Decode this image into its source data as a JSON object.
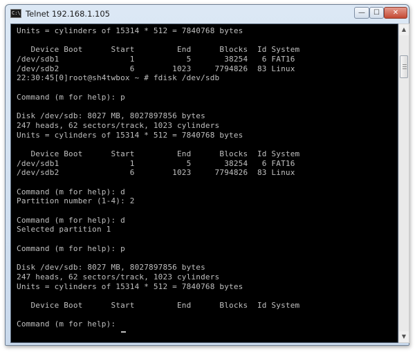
{
  "window": {
    "title": "Telnet 192.168.1.105",
    "icon_label": "C:\\",
    "minimize_glyph": "—",
    "maximize_glyph": "☐",
    "close_glyph": "✕"
  },
  "console": {
    "lines": [
      "Units = cylinders of 15314 * 512 = 7840768 bytes",
      "",
      "   Device Boot      Start         End      Blocks  Id System",
      "/dev/sdb1               1           5       38254   6 FAT16",
      "/dev/sdb2               6        1023     7794826  83 Linux",
      "22:30:45[0]root@sh4twbox ~ # fdisk /dev/sdb",
      "",
      "Command (m for help): p",
      "",
      "Disk /dev/sdb: 8027 MB, 8027897856 bytes",
      "247 heads, 62 sectors/track, 1023 cylinders",
      "Units = cylinders of 15314 * 512 = 7840768 bytes",
      "",
      "   Device Boot      Start         End      Blocks  Id System",
      "/dev/sdb1               1           5       38254   6 FAT16",
      "/dev/sdb2               6        1023     7794826  83 Linux",
      "",
      "Command (m for help): d",
      "Partition number (1-4): 2",
      "",
      "Command (m for help): d",
      "Selected partition 1",
      "",
      "Command (m for help): p",
      "",
      "Disk /dev/sdb: 8027 MB, 8027897856 bytes",
      "247 heads, 62 sectors/track, 1023 cylinders",
      "Units = cylinders of 15314 * 512 = 7840768 bytes",
      "",
      "   Device Boot      Start         End      Blocks  Id System",
      "",
      "Command (m for help): "
    ]
  },
  "scrollbar": {
    "up_glyph": "▲",
    "down_glyph": "▼"
  }
}
